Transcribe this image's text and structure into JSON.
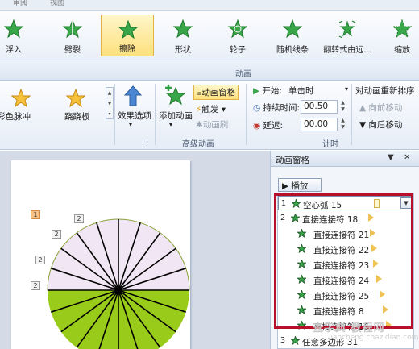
{
  "tabs": {
    "left": "审阅",
    "right": "视图"
  },
  "gallery": {
    "items": [
      {
        "label": "浮入",
        "icon": "float-in-star-icon"
      },
      {
        "label": "劈裂",
        "icon": "split-star-icon"
      },
      {
        "label": "擦除",
        "icon": "wipe-star-icon",
        "selected": true
      },
      {
        "label": "形状",
        "icon": "shape-star-icon"
      },
      {
        "label": "轮子",
        "icon": "wheel-star-icon"
      },
      {
        "label": "随机线条",
        "icon": "random-bars-star-icon"
      },
      {
        "label": "翻转式由远...",
        "icon": "grow-turn-star-icon"
      },
      {
        "label": "缩放",
        "icon": "zoom-star-icon"
      }
    ],
    "group_title": "动画"
  },
  "ribbon2": {
    "effect_left": "彩色脉冲",
    "effect_right": "跷跷板",
    "effect_options": "效果选项",
    "add_animation": "添加动画",
    "animation_pane": "动画窗格",
    "trigger": "触发",
    "animation_painter": "动画刷",
    "advanced_group": "高级动画",
    "start_label": "开始:",
    "start_value": "单击时",
    "duration_label": "持续时间:",
    "duration_value": "00.50",
    "delay_label": "延迟:",
    "delay_value": "00.00",
    "timing_group": "计时",
    "reorder_title": "对动画重新排序",
    "move_earlier": "向前移动",
    "move_later": "向后移动"
  },
  "slide": {
    "tags": [
      "1",
      "2",
      "2",
      "2",
      "2"
    ],
    "colors": {
      "top_half": "#f1e6f3",
      "bottom_half": "#99cc1a",
      "lines": "#000000"
    }
  },
  "pane": {
    "title": "动画窗格",
    "play": "播放",
    "items": [
      {
        "num": "1",
        "name": "空心弧",
        "id": "15"
      },
      {
        "num": "2",
        "name": "直接连接符",
        "id": "18"
      },
      {
        "num": "",
        "name": "直接连接符",
        "id": "21"
      },
      {
        "num": "",
        "name": "直接连接符",
        "id": "22"
      },
      {
        "num": "",
        "name": "直接连接符",
        "id": "23"
      },
      {
        "num": "",
        "name": "直接连接符",
        "id": "24"
      },
      {
        "num": "",
        "name": "直接连接符",
        "id": "25"
      },
      {
        "num": "",
        "name": "直接连接符",
        "id": "8"
      },
      {
        "num": "",
        "name": "直接连接符",
        "id": "16"
      },
      {
        "num": "3",
        "name": "任意多边形",
        "id": "31"
      }
    ]
  },
  "watermark": {
    "main": "查字典 教程网",
    "sub": "jiaocheng.chazidian.com"
  },
  "colors": {
    "highlight": "#fde07e",
    "frame": "#b8102a",
    "star": "#3aa64a"
  }
}
